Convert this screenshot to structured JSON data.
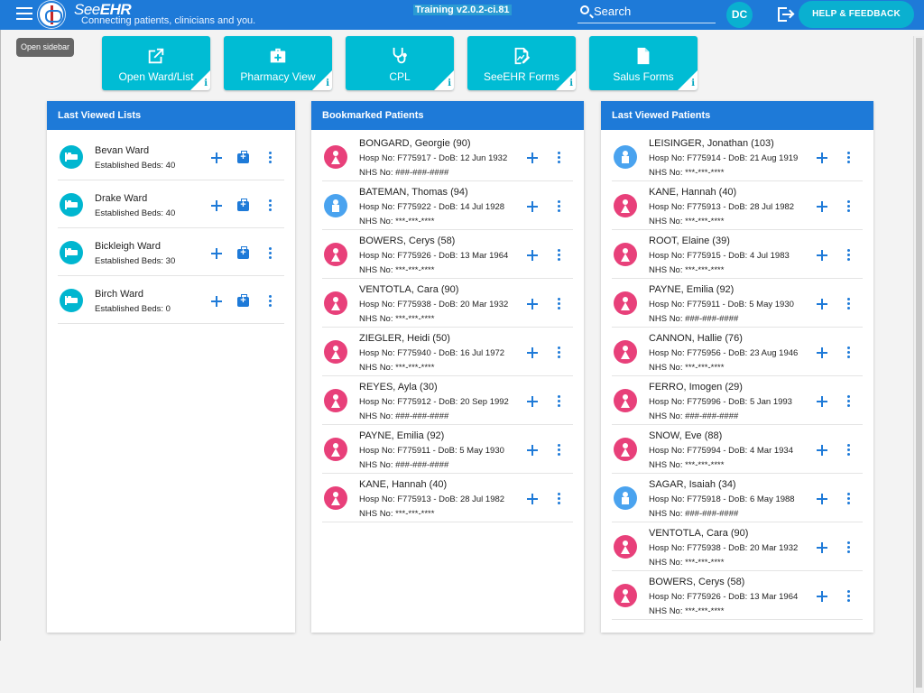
{
  "header": {
    "brand_see": "See",
    "brand_ehr": "EHR",
    "tagline": "Connecting patients, clinicians and you.",
    "version": "Training v2.0.2-ci.81",
    "search_placeholder": "Search",
    "user_initials": "DC",
    "help_label": "HELP & FEEDBACK",
    "tooltip": "Open sidebar"
  },
  "tiles": [
    {
      "label": "Open Ward/List",
      "icon": "open-external-icon",
      "info": "i"
    },
    {
      "label": "Pharmacy View",
      "icon": "medical-bag-icon",
      "info": "i"
    },
    {
      "label": "CPL",
      "icon": "stethoscope-icon",
      "info": "i"
    },
    {
      "label": "SeeEHR Forms",
      "icon": "form-edit-icon",
      "info": "i"
    },
    {
      "label": "Salus Forms",
      "icon": "document-icon",
      "info": "i"
    }
  ],
  "panels": {
    "lists": {
      "title": "Last Viewed Lists",
      "items": [
        {
          "name": "Bevan Ward",
          "beds": "Established Beds: 40"
        },
        {
          "name": "Drake Ward",
          "beds": "Established Beds: 40"
        },
        {
          "name": "Bickleigh Ward",
          "beds": "Established Beds: 30"
        },
        {
          "name": "Birch Ward",
          "beds": "Established Beds: 0"
        }
      ]
    },
    "bookmarked": {
      "title": "Bookmarked Patients",
      "items": [
        {
          "name": "BONGARD, Georgie (90)",
          "hosp": "Hosp No: F775917 - DoB: 12 Jun 1932",
          "nhs": "NHS No: ###-###-####",
          "sex": "female"
        },
        {
          "name": "BATEMAN, Thomas (94)",
          "hosp": "Hosp No: F775922 - DoB: 14 Jul 1928",
          "nhs": "NHS No: ***-***-****",
          "sex": "male"
        },
        {
          "name": "BOWERS, Cerys (58)",
          "hosp": "Hosp No: F775926 - DoB: 13 Mar 1964",
          "nhs": "NHS No: ***-***-****",
          "sex": "female"
        },
        {
          "name": "VENTOTLA, Cara (90)",
          "hosp": "Hosp No: F775938 - DoB: 20 Mar 1932",
          "nhs": "NHS No: ***-***-****",
          "sex": "female"
        },
        {
          "name": "ZIEGLER, Heidi (50)",
          "hosp": "Hosp No: F775940 - DoB: 16 Jul 1972",
          "nhs": "NHS No: ***-***-****",
          "sex": "female"
        },
        {
          "name": "REYES, Ayla (30)",
          "hosp": "Hosp No: F775912 - DoB: 20 Sep 1992",
          "nhs": "NHS No: ###-###-####",
          "sex": "female"
        },
        {
          "name": "PAYNE, Emilia (92)",
          "hosp": "Hosp No: F775911 - DoB: 5 May 1930",
          "nhs": "NHS No: ###-###-####",
          "sex": "female"
        },
        {
          "name": "KANE, Hannah (40)",
          "hosp": "Hosp No: F775913 - DoB: 28 Jul 1982",
          "nhs": "NHS No: ***-***-****",
          "sex": "female"
        }
      ]
    },
    "recent": {
      "title": "Last Viewed Patients",
      "items": [
        {
          "name": "LEISINGER, Jonathan (103)",
          "hosp": "Hosp No: F775914 - DoB: 21 Aug 1919",
          "nhs": "NHS No: ***-***-****",
          "sex": "male"
        },
        {
          "name": "KANE, Hannah (40)",
          "hosp": "Hosp No: F775913 - DoB: 28 Jul 1982",
          "nhs": "NHS No: ***-***-****",
          "sex": "female"
        },
        {
          "name": "ROOT, Elaine (39)",
          "hosp": "Hosp No: F775915 - DoB: 4 Jul 1983",
          "nhs": "NHS No: ***-***-****",
          "sex": "female"
        },
        {
          "name": "PAYNE, Emilia (92)",
          "hosp": "Hosp No: F775911 - DoB: 5 May 1930",
          "nhs": "NHS No: ###-###-####",
          "sex": "female"
        },
        {
          "name": "CANNON, Hallie (76)",
          "hosp": "Hosp No: F775956 - DoB: 23 Aug 1946",
          "nhs": "NHS No: ***-***-****",
          "sex": "female"
        },
        {
          "name": "FERRO, Imogen (29)",
          "hosp": "Hosp No: F775996 - DoB: 5 Jan 1993",
          "nhs": "NHS No: ###-###-####",
          "sex": "female"
        },
        {
          "name": "SNOW, Eve (88)",
          "hosp": "Hosp No: F775994 - DoB: 4 Mar 1934",
          "nhs": "NHS No: ***-***-****",
          "sex": "female"
        },
        {
          "name": "SAGAR, Isaiah (34)",
          "hosp": "Hosp No: F775918 - DoB: 6 May 1988",
          "nhs": "NHS No: ###-###-####",
          "sex": "male"
        },
        {
          "name": "VENTOTLA, Cara (90)",
          "hosp": "Hosp No: F775938 - DoB: 20 Mar 1932",
          "nhs": "NHS No: ***-***-****",
          "sex": "female"
        },
        {
          "name": "BOWERS, Cerys (58)",
          "hosp": "Hosp No: F775926 - DoB: 13 Mar 1964",
          "nhs": "NHS No: ***-***-****",
          "sex": "female"
        }
      ]
    }
  },
  "colors": {
    "primary": "#1e7ad8",
    "accent": "#00bcd4",
    "female": "#e8407a",
    "male": "#4aa3ef"
  }
}
